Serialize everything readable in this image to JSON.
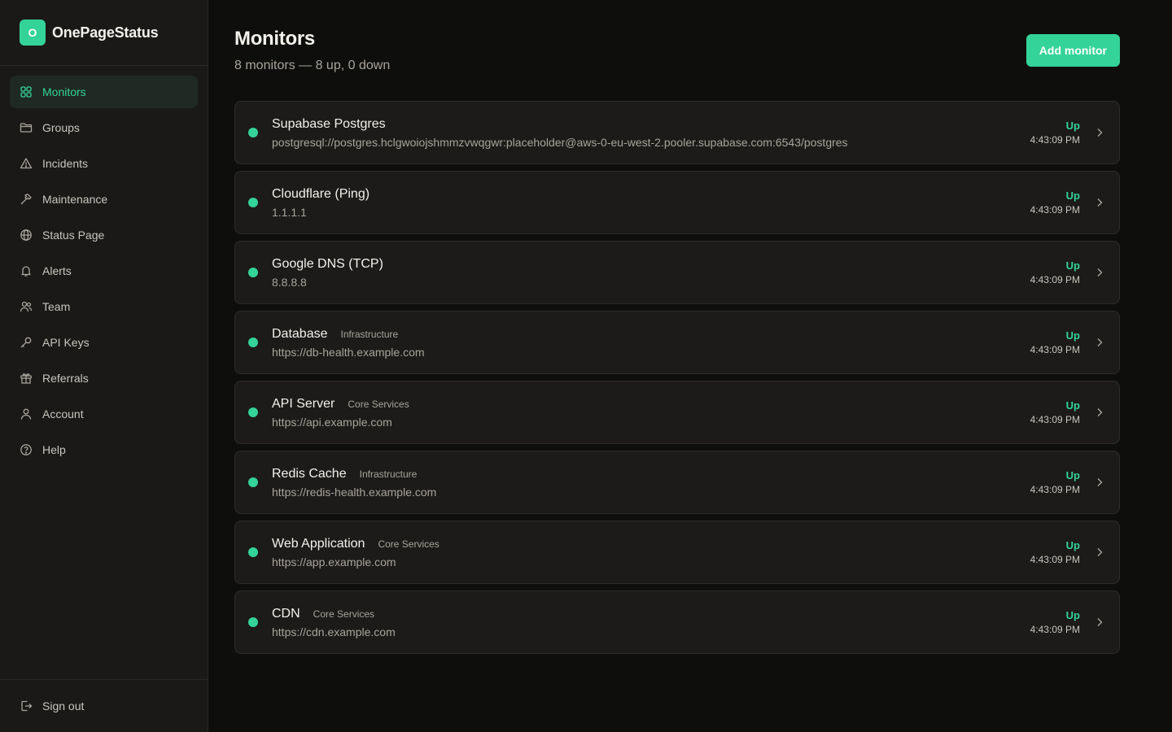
{
  "brand": {
    "logo_letter": "O",
    "name": "OnePageStatus"
  },
  "sidebar": {
    "items": [
      {
        "label": "Monitors",
        "icon": "grid-icon",
        "active": true
      },
      {
        "label": "Groups",
        "icon": "folder-icon"
      },
      {
        "label": "Incidents",
        "icon": "warning-icon"
      },
      {
        "label": "Maintenance",
        "icon": "hammer-icon"
      },
      {
        "label": "Status Page",
        "icon": "globe-icon"
      },
      {
        "label": "Alerts",
        "icon": "bell-icon"
      },
      {
        "label": "Team",
        "icon": "users-icon"
      },
      {
        "label": "API Keys",
        "icon": "key-icon"
      },
      {
        "label": "Referrals",
        "icon": "gift-icon"
      },
      {
        "label": "Account",
        "icon": "user-icon"
      },
      {
        "label": "Help",
        "icon": "help-icon"
      }
    ],
    "signout_label": "Sign out"
  },
  "header": {
    "title": "Monitors",
    "subtitle": "8 monitors — 8 up, 0 down",
    "add_label": "Add monitor"
  },
  "colors": {
    "accent": "#34d399",
    "background": "#0e0e0d",
    "card": "#1c1b1a"
  },
  "monitors": [
    {
      "name": "Supabase Postgres",
      "group": "",
      "target": "postgresql://postgres.hclgwoiojshmmzvwqgwr:placeholder@aws-0-eu-west-2.pooler.supabase.com:6543/postgres",
      "status": "Up",
      "time": "4:43:09 PM"
    },
    {
      "name": "Cloudflare (Ping)",
      "group": "",
      "target": "1.1.1.1",
      "status": "Up",
      "time": "4:43:09 PM"
    },
    {
      "name": "Google DNS (TCP)",
      "group": "",
      "target": "8.8.8.8",
      "status": "Up",
      "time": "4:43:09 PM"
    },
    {
      "name": "Database",
      "group": "Infrastructure",
      "target": "https://db-health.example.com",
      "status": "Up",
      "time": "4:43:09 PM"
    },
    {
      "name": "API Server",
      "group": "Core Services",
      "target": "https://api.example.com",
      "status": "Up",
      "time": "4:43:09 PM"
    },
    {
      "name": "Redis Cache",
      "group": "Infrastructure",
      "target": "https://redis-health.example.com",
      "status": "Up",
      "time": "4:43:09 PM"
    },
    {
      "name": "Web Application",
      "group": "Core Services",
      "target": "https://app.example.com",
      "status": "Up",
      "time": "4:43:09 PM"
    },
    {
      "name": "CDN",
      "group": "Core Services",
      "target": "https://cdn.example.com",
      "status": "Up",
      "time": "4:43:09 PM"
    }
  ]
}
